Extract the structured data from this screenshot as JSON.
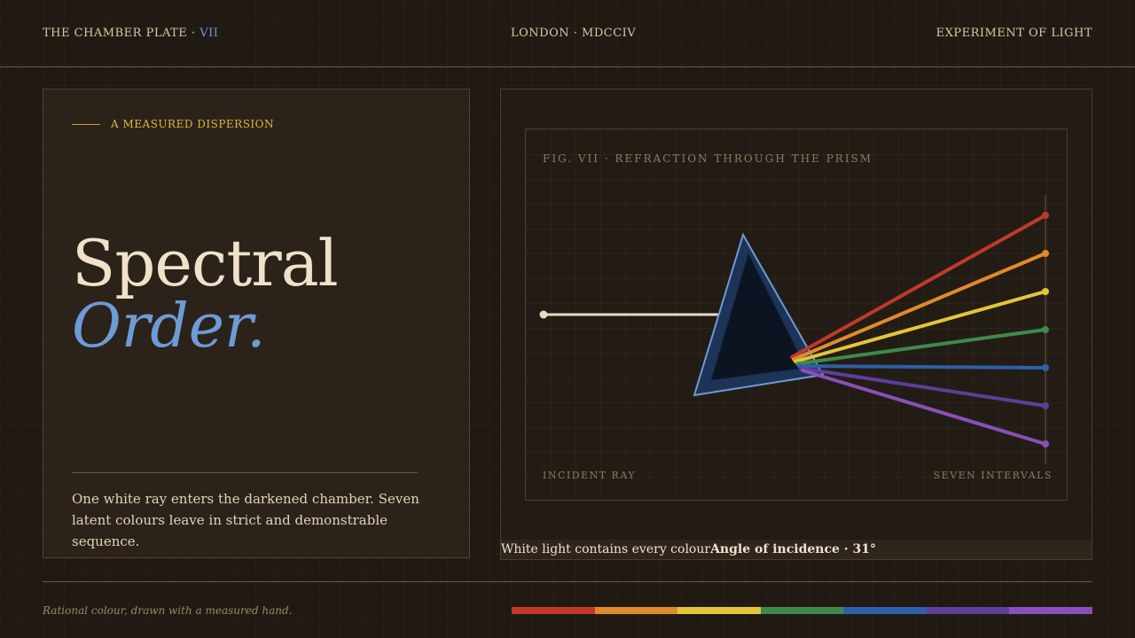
{
  "header": {
    "plate_label": "THE CHAMBER PLATE ·",
    "plate_numeral": "VII",
    "center": "LONDON · MDCCIV",
    "right": "EXPERIMENT OF LIGHT"
  },
  "intro": {
    "eyebrow": "A MEASURED DISPERSION",
    "title_line1": "Spectral",
    "title_line2": "Order.",
    "description": "One white ray enters the darkened chamber. Seven latent colours leave in strict and demonstrable sequence."
  },
  "figure": {
    "caption": "FIG. VII · REFRACTION THROUGH THE PRISM",
    "left_label": "INCIDENT RAY",
    "right_label": "SEVEN INTERVALS",
    "incident_color": "#e8d9c0",
    "prism_color": "#6d9bd6",
    "rays": [
      {
        "color": "#c0392b",
        "rank": 1
      },
      {
        "color": "#e08a2e",
        "rank": 2
      },
      {
        "color": "#e3c53a",
        "rank": 3
      },
      {
        "color": "#3f8a4a",
        "rank": 4
      },
      {
        "color": "#2f5fa8",
        "rank": 5
      },
      {
        "color": "#5b3f9a",
        "rank": 6
      },
      {
        "color": "#8a4fb8",
        "rank": 7
      }
    ]
  },
  "caption_bar": {
    "text": "White light contains every colour",
    "angle": "Angle of incidence · 31°"
  },
  "footer": {
    "note": "Rational colour, drawn with a measured hand.",
    "spectrum_colors": [
      "#c0392b",
      "#e08a2e",
      "#e3c53a",
      "#3f8a4a",
      "#2f5fa8",
      "#5b3f9a",
      "#8a4fb8"
    ]
  }
}
